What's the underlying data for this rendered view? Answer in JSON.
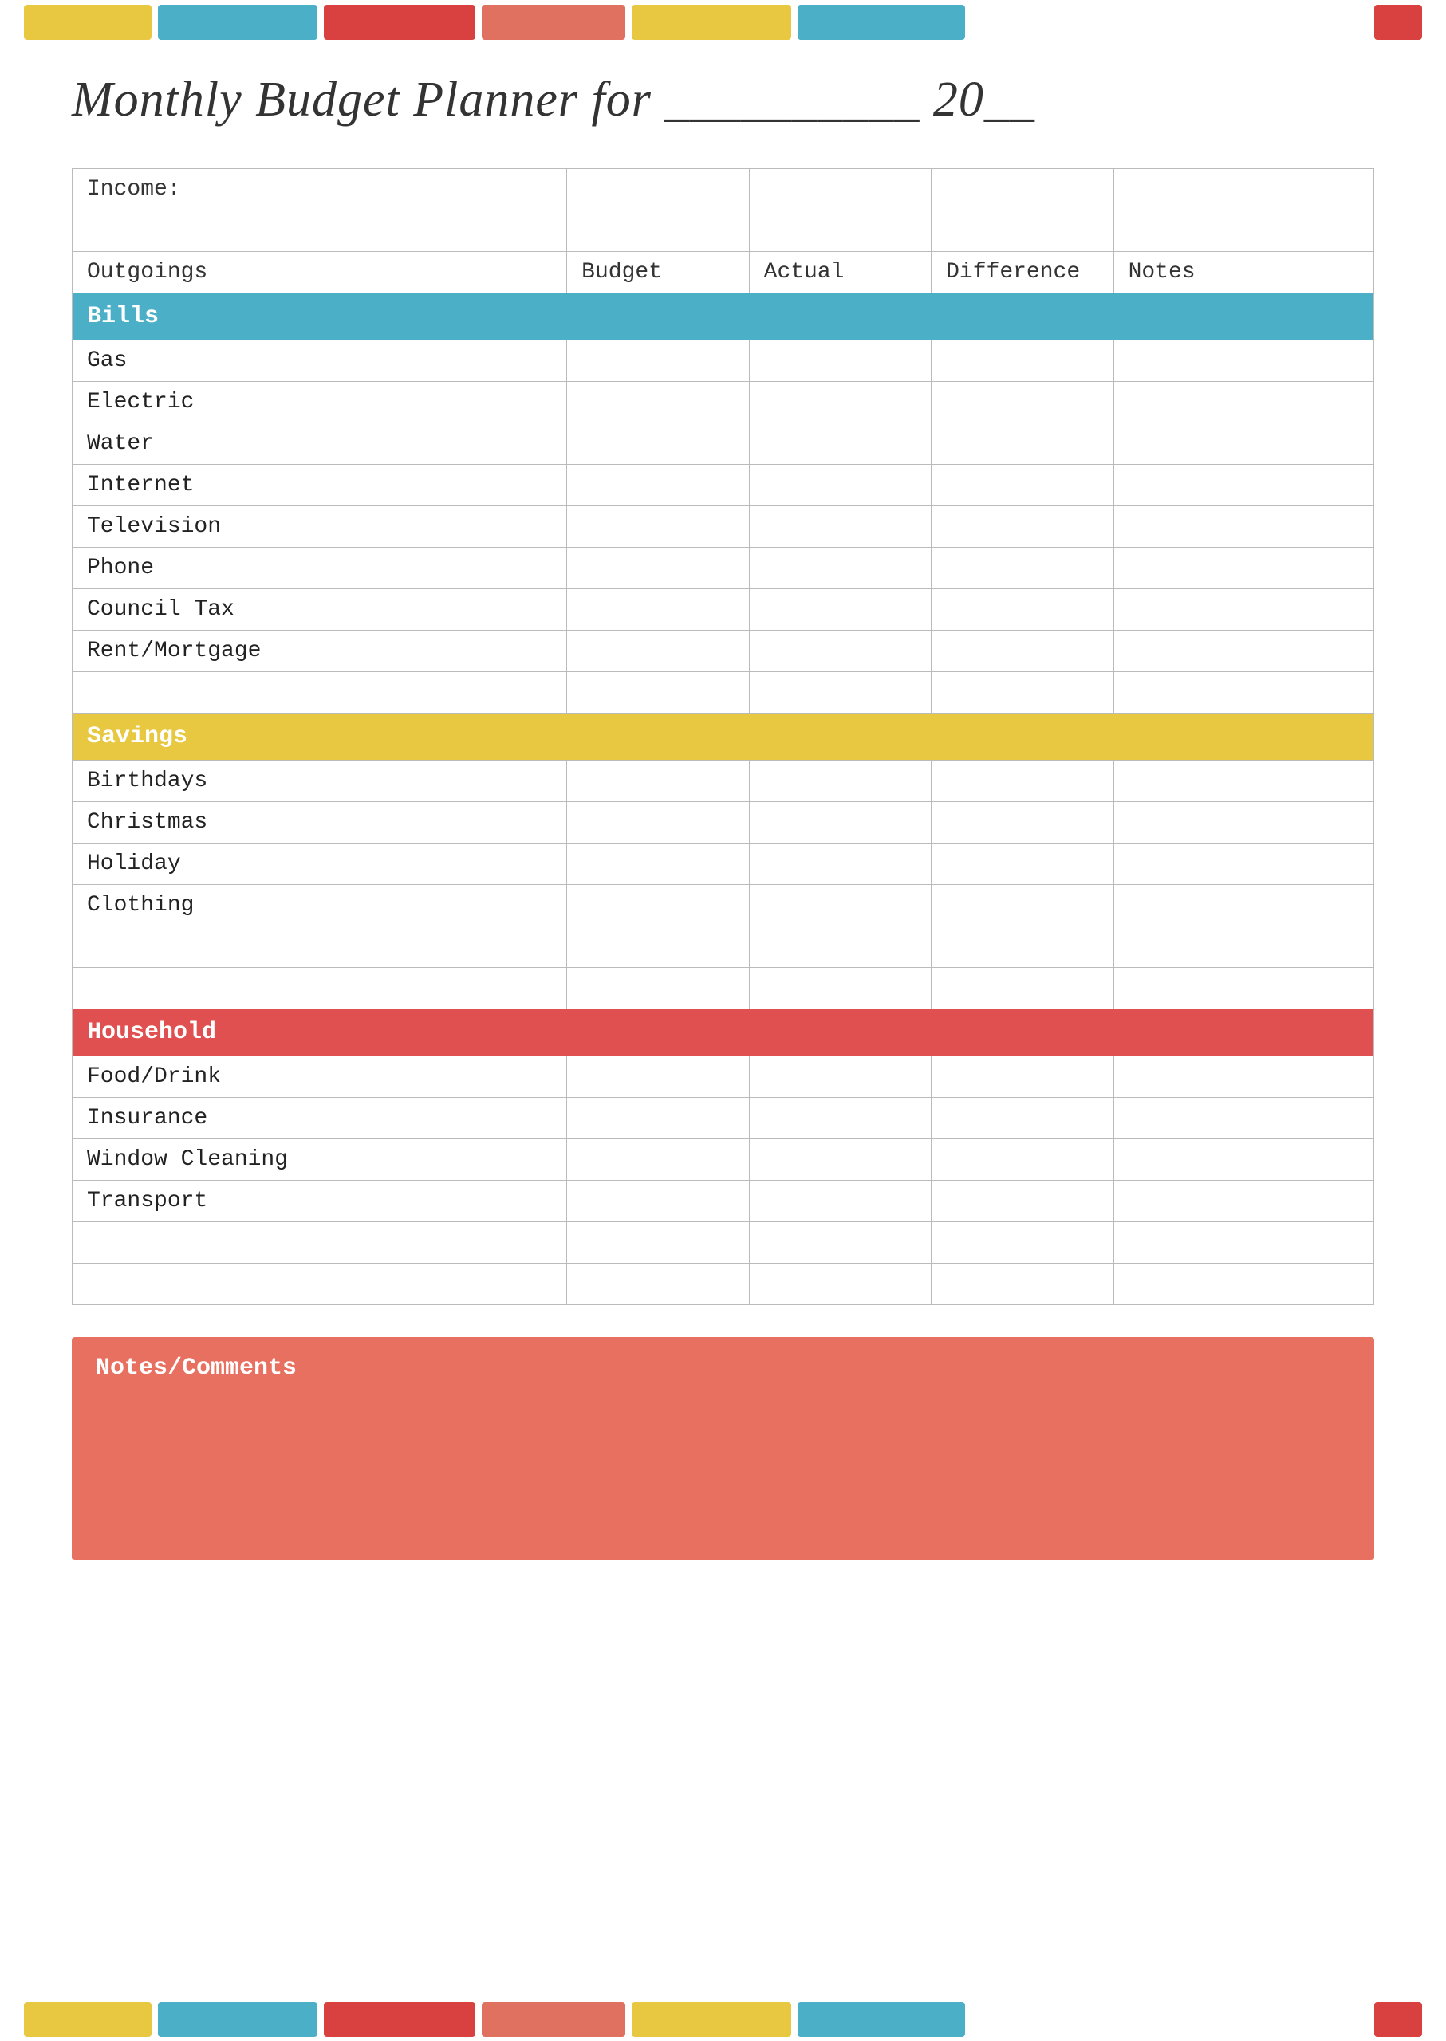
{
  "page": {
    "title": "Monthly Budget Planner for __________ 20__",
    "title_prefix": "Monthly Budget Planner for",
    "title_line": "___________  20__"
  },
  "colors": {
    "yellow": "#E8C840",
    "teal": "#4CAFC8",
    "red": "#D94040",
    "salmon": "#E07060",
    "bills_bg": "#4CAFC8",
    "savings_bg": "#E8C840",
    "household_bg": "#E05050",
    "notes_bg": "#E87060"
  },
  "table": {
    "headers": [
      "Outgoings",
      "Budget",
      "Actual",
      "Difference",
      "Notes"
    ],
    "income_label": "Income:",
    "sections": [
      {
        "name": "Bills",
        "color": "bills",
        "rows": [
          "Gas",
          "Electric",
          "Water",
          "Internet",
          "Television",
          "Phone",
          "Council Tax",
          "Rent/Mortgage",
          ""
        ]
      },
      {
        "name": "Savings",
        "color": "savings",
        "rows": [
          "Birthdays",
          "Christmas",
          "Holiday",
          "Clothing",
          "",
          ""
        ]
      },
      {
        "name": "Household",
        "color": "household",
        "rows": [
          "Food/Drink",
          "Insurance",
          "Window Cleaning",
          "Transport",
          "",
          ""
        ]
      }
    ]
  },
  "notes_section": {
    "label": "Notes/Comments"
  }
}
